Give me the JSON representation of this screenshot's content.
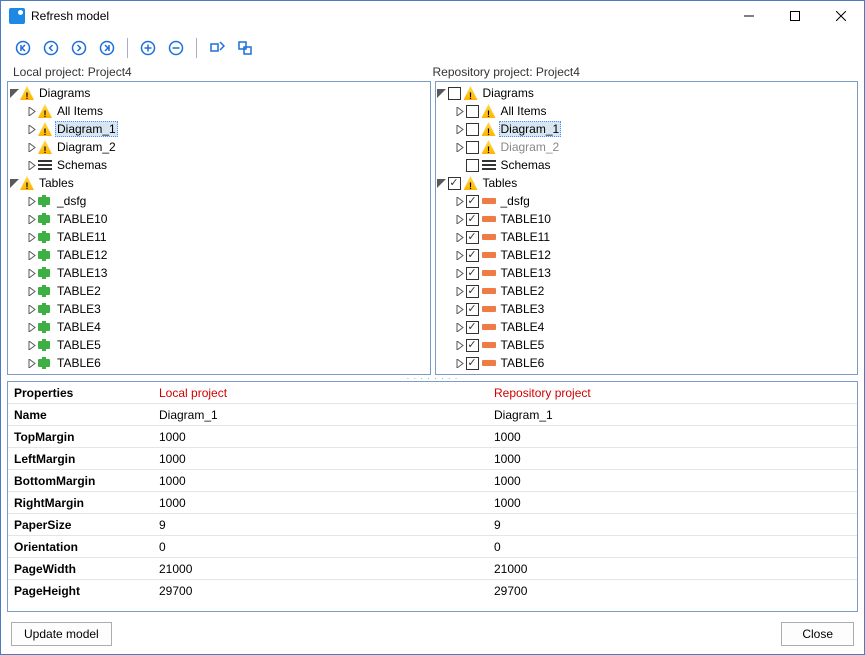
{
  "window": {
    "title": "Refresh model"
  },
  "labels": {
    "local_label": "Local project: Project4",
    "repo_label": "Repository project: Project4"
  },
  "trees": {
    "local": {
      "diagrams": {
        "label": "Diagrams",
        "items": [
          {
            "label": "All Items"
          },
          {
            "label": "Diagram_1",
            "selected": true
          },
          {
            "label": "Diagram_2"
          }
        ]
      },
      "schemas": {
        "label": "Schemas"
      },
      "tables": {
        "label": "Tables",
        "items": [
          {
            "label": "_dsfg"
          },
          {
            "label": "TABLE10"
          },
          {
            "label": "TABLE11"
          },
          {
            "label": "TABLE12"
          },
          {
            "label": "TABLE13"
          },
          {
            "label": "TABLE2"
          },
          {
            "label": "TABLE3"
          },
          {
            "label": "TABLE4"
          },
          {
            "label": "TABLE5"
          },
          {
            "label": "TABLE6"
          }
        ]
      }
    },
    "repo": {
      "diagrams": {
        "label": "Diagrams",
        "items": [
          {
            "label": "All Items"
          },
          {
            "label": "Diagram_1",
            "selected": true
          },
          {
            "label": "Diagram_2",
            "dim": true
          }
        ]
      },
      "schemas": {
        "label": "Schemas"
      },
      "tables": {
        "label": "Tables",
        "items": [
          {
            "label": "_dsfg"
          },
          {
            "label": "TABLE10"
          },
          {
            "label": "TABLE11"
          },
          {
            "label": "TABLE12"
          },
          {
            "label": "TABLE13"
          },
          {
            "label": "TABLE2"
          },
          {
            "label": "TABLE3"
          },
          {
            "label": "TABLE4"
          },
          {
            "label": "TABLE5"
          },
          {
            "label": "TABLE6"
          }
        ]
      }
    }
  },
  "properties": {
    "header": {
      "col1": "Properties",
      "col2": "Local project",
      "col3": "Repository project"
    },
    "rows": [
      {
        "name": "Name",
        "local": "Diagram_1",
        "repo": "Diagram_1"
      },
      {
        "name": "TopMargin",
        "local": "1000",
        "repo": "1000"
      },
      {
        "name": "LeftMargin",
        "local": "1000",
        "repo": "1000"
      },
      {
        "name": "BottomMargin",
        "local": "1000",
        "repo": "1000"
      },
      {
        "name": "RightMargin",
        "local": "1000",
        "repo": "1000"
      },
      {
        "name": "PaperSize",
        "local": "9",
        "repo": "9"
      },
      {
        "name": "Orientation",
        "local": "0",
        "repo": "0"
      },
      {
        "name": "PageWidth",
        "local": "21000",
        "repo": "21000"
      },
      {
        "name": "PageHeight",
        "local": "29700",
        "repo": "29700"
      }
    ]
  },
  "footer": {
    "update": "Update model",
    "close": "Close"
  }
}
